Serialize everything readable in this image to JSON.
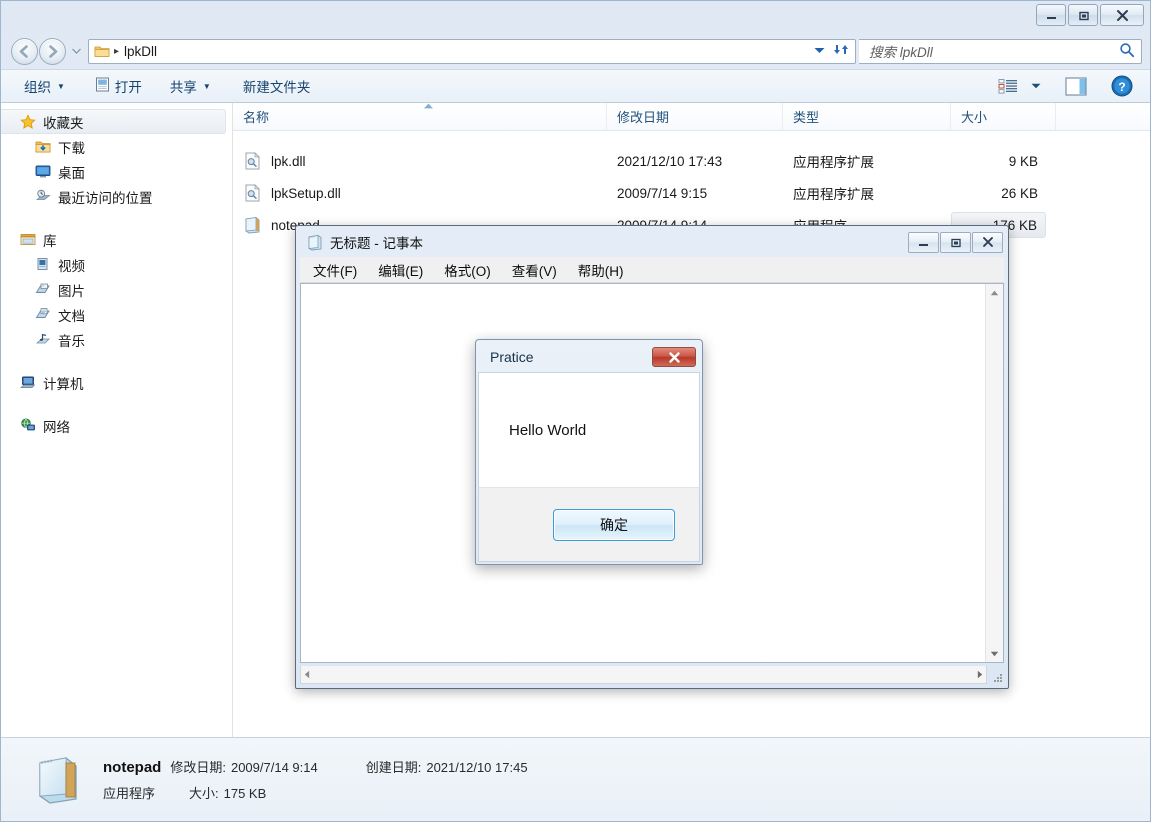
{
  "explorer": {
    "window_buttons": [
      {
        "name": "minimize",
        "glyph": "minimize-icon"
      },
      {
        "name": "maximize",
        "glyph": "maximize-icon"
      },
      {
        "name": "close",
        "glyph": "close-icon"
      }
    ],
    "address": {
      "back_tooltip": "后退",
      "forward_tooltip": "前进",
      "crumb": "lpkDll",
      "separator": "▸"
    },
    "search": {
      "placeholder": "搜索 lpkDll"
    },
    "toolbar": {
      "organize": "组织",
      "open": "打开",
      "share": "共享",
      "new_folder": "新建文件夹",
      "caret": "▼",
      "view_icon": "view-layout-icon",
      "preview_icon": "preview-pane-icon",
      "help_icon": "help-icon"
    },
    "navpane": {
      "groups": [
        {
          "header": {
            "label": "收藏夹",
            "icon": "star-icon",
            "selected": true
          },
          "items": [
            {
              "label": "下载",
              "icon": "downloads-folder-icon"
            },
            {
              "label": "桌面",
              "icon": "desktop-icon"
            },
            {
              "label": "最近访问的位置",
              "icon": "recent-places-icon"
            }
          ]
        },
        {
          "header": {
            "label": "库",
            "icon": "libraries-icon",
            "selected": false
          },
          "items": [
            {
              "label": "视频",
              "icon": "videos-icon"
            },
            {
              "label": "图片",
              "icon": "pictures-icon"
            },
            {
              "label": "文档",
              "icon": "documents-icon"
            },
            {
              "label": "音乐",
              "icon": "music-icon"
            }
          ]
        },
        {
          "header": {
            "label": "计算机",
            "icon": "computer-icon",
            "selected": false
          },
          "items": []
        },
        {
          "header": {
            "label": "网络",
            "icon": "network-icon",
            "selected": false
          },
          "items": []
        }
      ]
    },
    "filelist": {
      "columns": [
        {
          "key": "name",
          "label": "名称",
          "sorted": true,
          "sort_dir": "asc"
        },
        {
          "key": "date",
          "label": "修改日期"
        },
        {
          "key": "type",
          "label": "类型"
        },
        {
          "key": "size",
          "label": "大小"
        }
      ],
      "rows": [
        {
          "name": "lpk.dll",
          "date": "2021/12/10 17:43",
          "type": "应用程序扩展",
          "size": "9 KB",
          "icon": "dll-file-icon",
          "selected": false
        },
        {
          "name": "lpkSetup.dll",
          "date": "2009/7/14 9:15",
          "type": "应用程序扩展",
          "size": "26 KB",
          "icon": "dll-file-icon",
          "selected": false
        },
        {
          "name": "notepad",
          "date": "2009/7/14 9:14",
          "type": "应用程序",
          "size": "176 KB",
          "icon": "notepad-app-icon",
          "selected": true
        }
      ]
    },
    "details": {
      "icon": "notepad-app-icon",
      "name": "notepad",
      "modified_label": "修改日期:",
      "modified_value": "2009/7/14 9:14",
      "created_label": "创建日期:",
      "created_value": "2021/12/10 17:45",
      "type_value": "应用程序",
      "size_label": "大小:",
      "size_value": "175 KB"
    }
  },
  "notepad": {
    "title": "无标题 - 记事本",
    "title_icon": "notepad-doc-icon",
    "buttons": [
      {
        "name": "minimize",
        "glyph": "minimize-icon"
      },
      {
        "name": "maximize",
        "glyph": "maximize-icon"
      },
      {
        "name": "close",
        "glyph": "close-icon"
      }
    ],
    "menu": [
      {
        "label": "文件(F)"
      },
      {
        "label": "编辑(E)"
      },
      {
        "label": "格式(O)"
      },
      {
        "label": "查看(V)"
      },
      {
        "label": "帮助(H)"
      }
    ],
    "text": ""
  },
  "msgbox": {
    "title": "Pratice",
    "message": "Hello World",
    "ok_label": "确定",
    "close_icon": "close-icon",
    "close_color": "#c0392b"
  },
  "colors": {
    "accent": "#2a6ab5",
    "chrome": "#dfe8f3",
    "selection": "#e6eaf0",
    "dialog_close_red": "#c0392b"
  }
}
